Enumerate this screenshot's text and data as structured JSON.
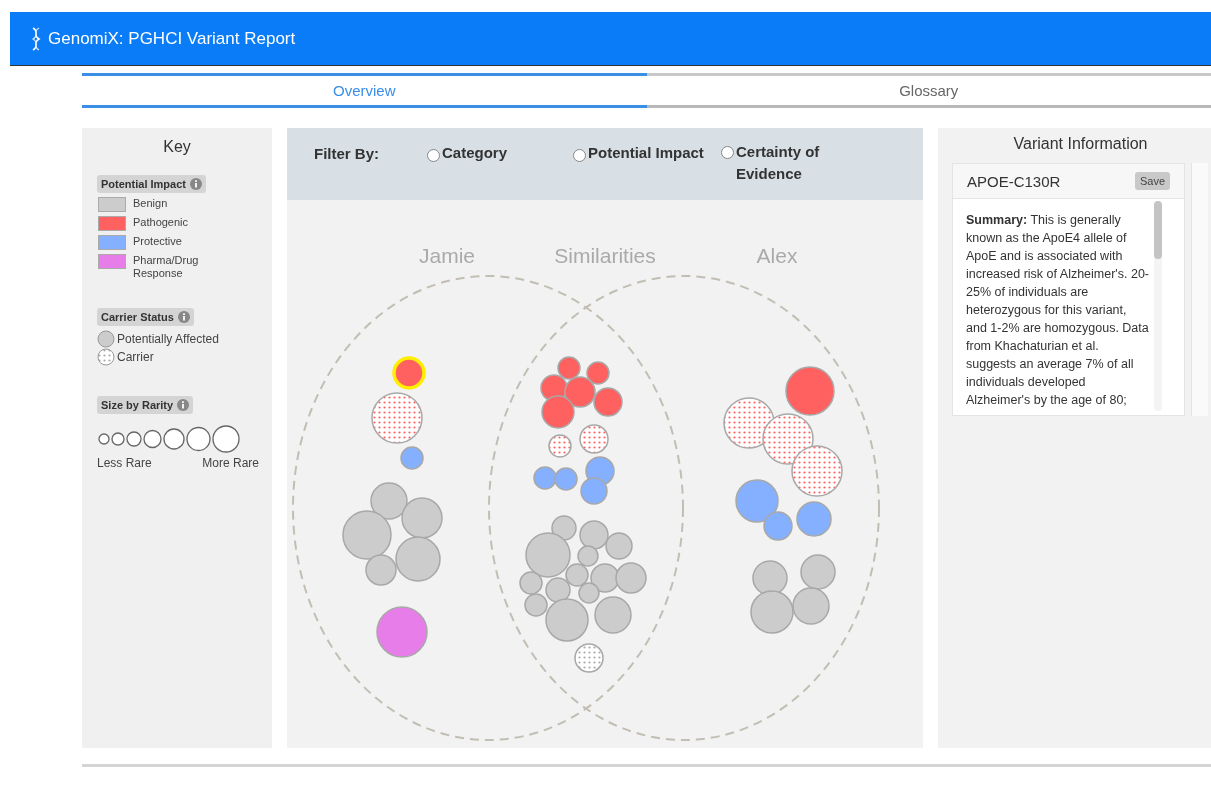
{
  "header": {
    "title": "GenomiX: PGHCI Variant Report"
  },
  "tabs": [
    {
      "label": "Overview",
      "selected": true
    },
    {
      "label": "Glossary",
      "selected": false
    }
  ],
  "key": {
    "title": "Key",
    "impact": {
      "heading": "Potential Impact",
      "items": [
        {
          "kind": "benign",
          "label": "Benign",
          "color": "#cccccc"
        },
        {
          "kind": "pathogenic",
          "label": "Pathogenic",
          "color": "#ff6161"
        },
        {
          "kind": "protective",
          "label": "Protective",
          "color": "#85b0ff"
        },
        {
          "kind": "pharma",
          "label": "Pharma/Drug Response",
          "color": "#e67de8"
        }
      ]
    },
    "carrier": {
      "heading": "Carrier Status",
      "items": [
        {
          "kind": "affected",
          "label": "Potentially Affected"
        },
        {
          "kind": "carrier",
          "label": "Carrier"
        }
      ]
    },
    "rarity": {
      "heading": "Size by Rarity",
      "less": "Less Rare",
      "more": "More Rare"
    }
  },
  "filter": {
    "label": "Filter By:",
    "options": [
      {
        "label": "Category",
        "selected": false
      },
      {
        "label": "Potential Impact",
        "selected": false
      },
      {
        "label": "Certainty of Evidence",
        "selected": false
      }
    ]
  },
  "venn": {
    "sets": [
      {
        "label": "Jamie"
      },
      {
        "label": "Similarities"
      },
      {
        "label": "Alex"
      }
    ],
    "bubbles": [
      {
        "kind": "pathogenic",
        "carrier": false,
        "selected": true
      },
      {
        "kind": "pathogenic",
        "carrier": true,
        "selected": false
      },
      {
        "kind": "protective",
        "carrier": false,
        "selected": false
      },
      {
        "kind": "benign",
        "carrier": false,
        "selected": false
      },
      {
        "kind": "benign",
        "carrier": false,
        "selected": false
      },
      {
        "kind": "benign",
        "carrier": false,
        "selected": false
      },
      {
        "kind": "benign",
        "carrier": false,
        "selected": false
      },
      {
        "kind": "benign",
        "carrier": false,
        "selected": false
      },
      {
        "kind": "pharma",
        "carrier": false,
        "selected": false
      },
      {
        "kind": "pathogenic",
        "carrier": false,
        "selected": false
      },
      {
        "kind": "pathogenic",
        "carrier": false,
        "selected": false
      },
      {
        "kind": "pathogenic",
        "carrier": false,
        "selected": false
      },
      {
        "kind": "pathogenic",
        "carrier": false,
        "selected": false
      },
      {
        "kind": "pathogenic",
        "carrier": false,
        "selected": false
      },
      {
        "kind": "pathogenic",
        "carrier": false,
        "selected": false
      },
      {
        "kind": "pathogenic",
        "carrier": true,
        "selected": false
      },
      {
        "kind": "pathogenic",
        "carrier": true,
        "selected": false
      },
      {
        "kind": "protective",
        "carrier": false,
        "selected": false
      },
      {
        "kind": "protective",
        "carrier": false,
        "selected": false
      },
      {
        "kind": "protective",
        "carrier": false,
        "selected": false
      },
      {
        "kind": "protective",
        "carrier": false,
        "selected": false
      },
      {
        "kind": "benign",
        "carrier": false,
        "selected": false
      },
      {
        "kind": "benign",
        "carrier": false,
        "selected": false
      },
      {
        "kind": "benign",
        "carrier": false,
        "selected": false
      },
      {
        "kind": "benign",
        "carrier": false,
        "selected": false
      },
      {
        "kind": "benign",
        "carrier": false,
        "selected": false
      },
      {
        "kind": "benign",
        "carrier": false,
        "selected": false
      },
      {
        "kind": "benign",
        "carrier": false,
        "selected": false
      },
      {
        "kind": "benign",
        "carrier": false,
        "selected": false
      },
      {
        "kind": "benign",
        "carrier": false,
        "selected": false
      },
      {
        "kind": "benign",
        "carrier": false,
        "selected": false
      },
      {
        "kind": "benign",
        "carrier": false,
        "selected": false
      },
      {
        "kind": "benign",
        "carrier": false,
        "selected": false
      },
      {
        "kind": "benign",
        "carrier": false,
        "selected": false
      },
      {
        "kind": "benign",
        "carrier": false,
        "selected": false
      },
      {
        "kind": "benign",
        "carrier": true,
        "selected": false
      },
      {
        "kind": "pathogenic",
        "carrier": false,
        "selected": false
      },
      {
        "kind": "pathogenic",
        "carrier": true,
        "selected": false
      },
      {
        "kind": "pathogenic",
        "carrier": true,
        "selected": false
      },
      {
        "kind": "pathogenic",
        "carrier": true,
        "selected": false
      },
      {
        "kind": "protective",
        "carrier": false,
        "selected": false
      },
      {
        "kind": "protective",
        "carrier": false,
        "selected": false
      },
      {
        "kind": "protective",
        "carrier": false,
        "selected": false
      },
      {
        "kind": "benign",
        "carrier": false,
        "selected": false
      },
      {
        "kind": "benign",
        "carrier": false,
        "selected": false
      },
      {
        "kind": "benign",
        "carrier": false,
        "selected": false
      },
      {
        "kind": "benign",
        "carrier": false,
        "selected": false
      }
    ]
  },
  "variant": {
    "heading": "Variant Information",
    "name": "APOE-C130R",
    "save": "Save",
    "summary": "**Summary:** This is generally known as the ApoE4 allele of ApoE and is associated with increased risk of Alzheimer's. 20-25% of individuals are heterozygous for this variant, and 1-2% are homozygous. Data from Khachaturian et al. suggests an average 7% of all individuals developed Alzheimer's by the age of 80;"
  }
}
